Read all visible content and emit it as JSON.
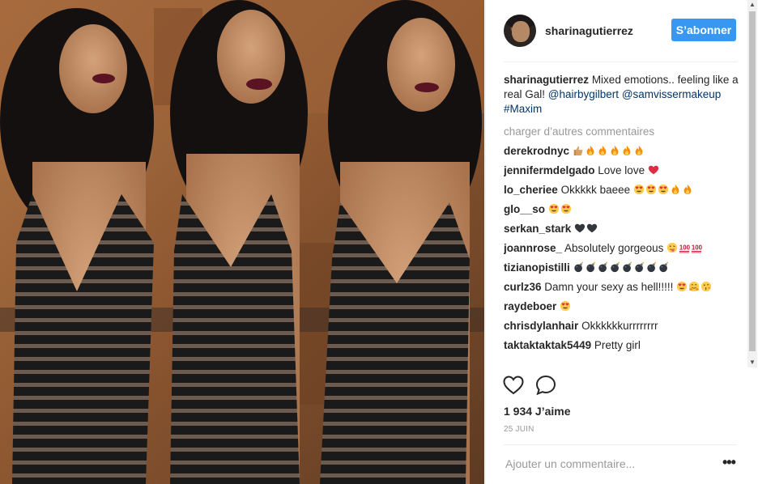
{
  "post": {
    "username": "sharinagutierrez",
    "follow_label": "S’abonner"
  },
  "caption": {
    "user": "sharinagutierrez",
    "text": "Mixed emotions.. feeling like a real Gal!",
    "mention1": "@hairbygilbert",
    "mention2": "@samvissermakeup",
    "hashtag": "#Maxim"
  },
  "load_more": "charger d’autres commentaires",
  "comments": [
    {
      "user": "derekrodnyc",
      "text": "",
      "emojis": [
        "thumb",
        "fire",
        "fire",
        "fire",
        "fire",
        "fire"
      ]
    },
    {
      "user": "jennifermdelgado",
      "text": "Love love",
      "emojis": [
        "heart"
      ]
    },
    {
      "user": "lo_cheriee",
      "text": "Okkkkk baeee",
      "emojis": [
        "hearteyes",
        "hearteyes",
        "hearteyes",
        "fire",
        "fire"
      ]
    },
    {
      "user": "glo__so",
      "text": "",
      "emojis": [
        "hearteyes",
        "hearteyes"
      ]
    },
    {
      "user": "serkan_stark",
      "text": "",
      "emojis": [
        "blackheart",
        "blackheart"
      ]
    },
    {
      "user": "joannrose_",
      "text": "Absolutely gorgeous",
      "emojis": [
        "tongue",
        "hundred",
        "hundred"
      ]
    },
    {
      "user": "tizianopistilli",
      "text": "",
      "emojis": [
        "bomb",
        "bomb",
        "bomb",
        "bomb",
        "bomb",
        "bomb",
        "bomb",
        "bomb"
      ]
    },
    {
      "user": "curlz36",
      "text": "Damn your sexy as hell!!!!!",
      "emojis": [
        "hearteyes",
        "hug",
        "kiss"
      ]
    },
    {
      "user": "raydeboer",
      "text": "",
      "emojis": [
        "hearteyes"
      ]
    },
    {
      "user": "chrisdylanhair",
      "text": "Okkkkkkurrrrrrrr",
      "emojis": []
    },
    {
      "user": "taktaktaktak5449",
      "text": "Pretty girl",
      "emojis": []
    }
  ],
  "likes_text": "1 934 J’aime",
  "date_text": "25 JUIN",
  "add_comment_placeholder": "Ajouter un commentaire...",
  "more_options": "•••",
  "icons": {
    "like": "heart-outline-icon",
    "comment": "speech-bubble-icon",
    "scroll_up": "triangle-up",
    "scroll_down": "triangle-down"
  },
  "colors": {
    "accent": "#3897f0",
    "link": "#003569",
    "muted": "#999999"
  }
}
